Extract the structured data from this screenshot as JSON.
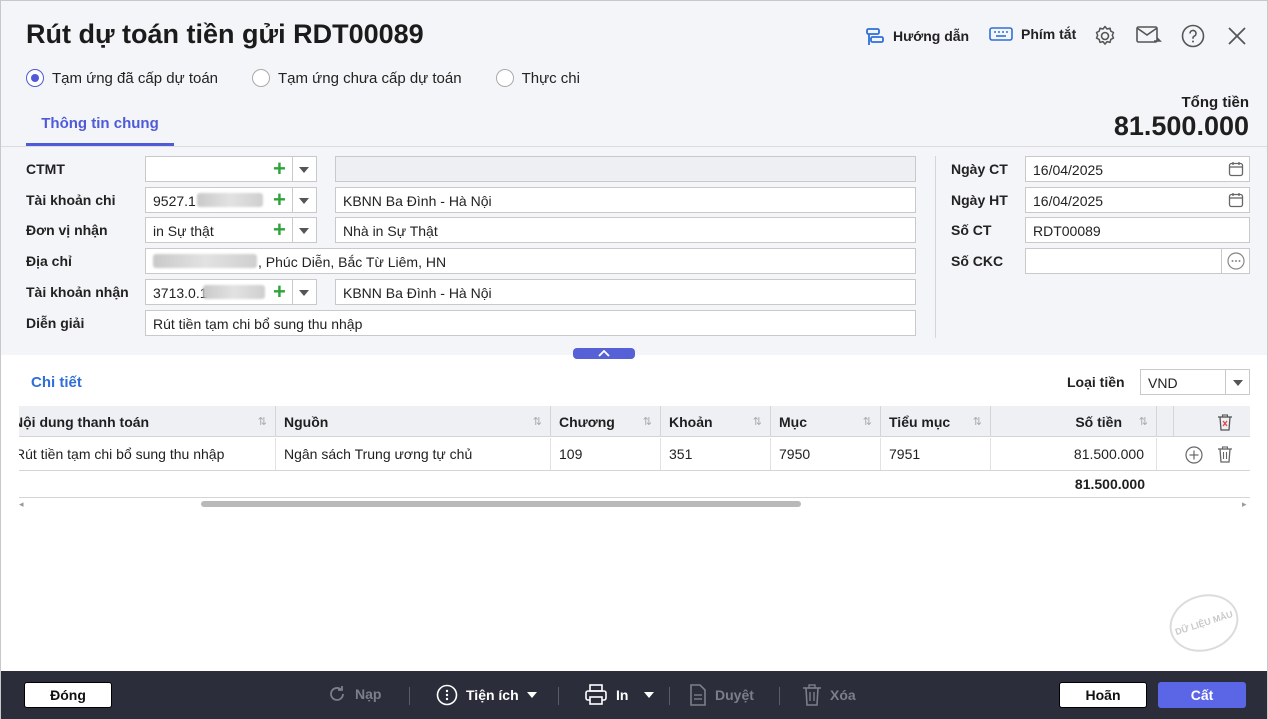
{
  "window": {
    "title": "Rút dự toán tiền gửi RDT00089",
    "guide_label": "Hướng dẫn",
    "shortcut_label": "Phím tắt"
  },
  "options": [
    {
      "label": "Tạm ứng đã cấp dự toán",
      "selected": true
    },
    {
      "label": "Tạm ứng chưa cấp dự toán",
      "selected": false
    },
    {
      "label": "Thực chi",
      "selected": false
    }
  ],
  "tab": {
    "label": "Thông tin chung"
  },
  "total": {
    "label": "Tổng tiền",
    "value": "81.500.000"
  },
  "form": {
    "ctmt": {
      "label": "CTMT",
      "value": "",
      "name": ""
    },
    "tk_chi": {
      "label": "Tài khoản chi",
      "value": "9527.1",
      "name": "KBNN Ba Đình - Hà Nội"
    },
    "don_vi": {
      "label": "Đơn vị nhận",
      "value": "in Sự thật",
      "name": "Nhà in Sự Thật"
    },
    "dia_chi": {
      "label": "Địa chỉ",
      "value": ", Phúc Diễn, Bắc Từ Liêm, HN"
    },
    "tk_nhan": {
      "label": "Tài khoản nhận",
      "value": "3713.0.1",
      "name": "KBNN Ba Đình - Hà Nội"
    },
    "dien_giai": {
      "label": "Diễn giải",
      "value": "Rút tiền tạm chi bổ sung thu nhập"
    }
  },
  "right_form": {
    "ngay_ct": {
      "label": "Ngày CT",
      "value": "16/04/2025"
    },
    "ngay_ht": {
      "label": "Ngày HT",
      "value": "16/04/2025"
    },
    "so_ct": {
      "label": "Số CT",
      "value": "RDT00089"
    },
    "so_ckc": {
      "label": "Số CKC",
      "value": ""
    }
  },
  "detail": {
    "title": "Chi tiết",
    "currency_label": "Loại tiền",
    "currency_value": "VND",
    "columns": [
      "Nội dung thanh toán",
      "Nguồn",
      "Chương",
      "Khoản",
      "Mục",
      "Tiểu mục",
      "Số tiền"
    ],
    "rows": [
      {
        "noi_dung": "Rút tiền tạm chi bổ sung thu nhập",
        "nguon": "Ngân sách Trung ương tự chủ",
        "chuong": "109",
        "khoan": "351",
        "muc": "7950",
        "tieu_muc": "7951",
        "so_tien": "81.500.000"
      }
    ],
    "total": "81.500.000"
  },
  "footer": {
    "close": "Đóng",
    "reload": "Nạp",
    "utilities": "Tiện ích",
    "print": "In",
    "approve": "Duyệt",
    "delete": "Xóa",
    "cancel": "Hoãn",
    "save": "Cất"
  },
  "watermark": "DỮ LIỆU MẪU",
  "colors": {
    "accent": "#4e5ad8",
    "footer": "#2b2e3a",
    "plus": "#2fa33b"
  }
}
